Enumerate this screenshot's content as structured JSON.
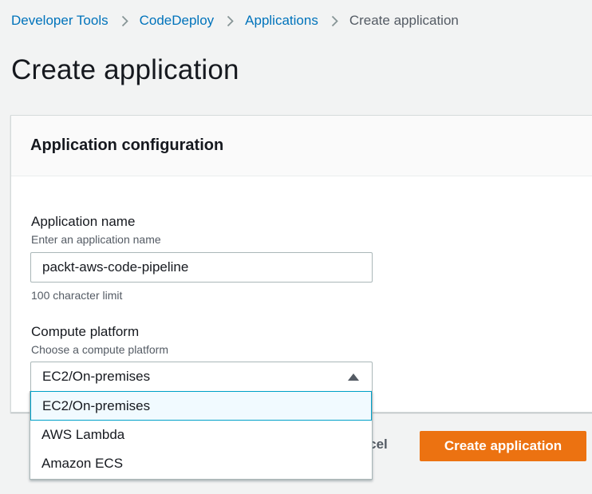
{
  "breadcrumb": {
    "items": [
      "Developer Tools",
      "CodeDeploy",
      "Applications"
    ],
    "current": "Create application",
    "separator_icon": "chevron-right-icon"
  },
  "page": {
    "title": "Create application"
  },
  "panel": {
    "title": "Application configuration",
    "app_name": {
      "label": "Application name",
      "description": "Enter an application name",
      "value": "packt-aws-code-pipeline",
      "constraint": "100 character limit"
    },
    "compute_platform": {
      "label": "Compute platform",
      "description": "Choose a compute platform",
      "selected": "EC2/On-premises",
      "caret_icon": "caret-up-icon",
      "options": [
        "EC2/On-premises",
        "AWS Lambda",
        "Amazon ECS"
      ]
    }
  },
  "actions": {
    "cancel_label": "Cancel",
    "create_label": "Create application"
  },
  "colors": {
    "link": "#0073bb",
    "primary_button": "#ec7211",
    "selected_option_border": "#00a1c9",
    "background": "#f2f3f3"
  }
}
